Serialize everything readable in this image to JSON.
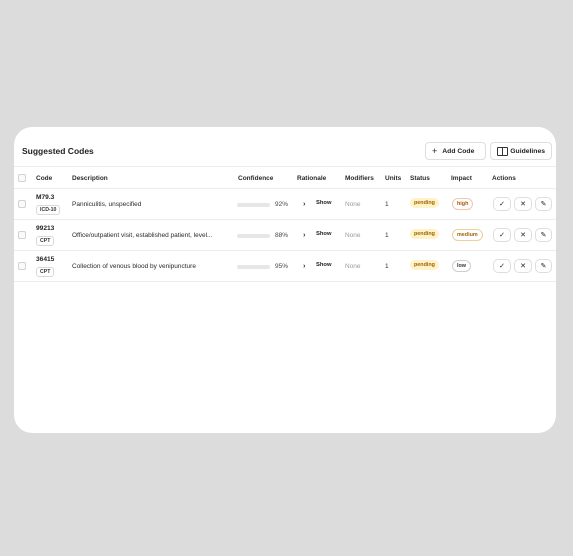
{
  "panel": {
    "title": "Suggested Codes",
    "add_label": "Add Code",
    "guidelines_label": "Guidelines"
  },
  "columns": {
    "code": "Code",
    "description": "Description",
    "confidence": "Confidence",
    "rationale": "Rationale",
    "modifiers": "Modifiers",
    "units": "Units",
    "status": "Status",
    "impact": "Impact",
    "actions": "Actions"
  },
  "rows": [
    {
      "code": "M79.3",
      "code_type": "ICD-10",
      "description": "Panniculitis, unspecified",
      "confidence": 0.92,
      "confidence_label": "92%",
      "rationale_label": "Show",
      "modifiers": "None",
      "units": "1",
      "status": "pending",
      "impact": "high"
    },
    {
      "code": "99213",
      "code_type": "CPT",
      "description": "Office/outpatient visit, established patient, level...",
      "confidence": 0.88,
      "confidence_label": "88%",
      "rationale_label": "Show",
      "modifiers": "None",
      "units": "1",
      "status": "pending",
      "impact": "medium"
    },
    {
      "code": "36415",
      "code_type": "CPT",
      "description": "Collection of venous blood by venipuncture",
      "confidence": 0.95,
      "confidence_label": "95%",
      "rationale_label": "Show",
      "modifiers": "None",
      "units": "1",
      "status": "pending",
      "impact": "low"
    }
  ],
  "colors": {
    "confidence_bar": "#22c55e",
    "status_pending_bg": "#fef3c7",
    "status_pending_text": "#a16207"
  },
  "icons": {
    "add": "plus-icon",
    "guidelines": "book-icon",
    "rationale": "chevron-right-icon",
    "accept": "check-icon",
    "reject": "close-icon",
    "edit": "edit-icon"
  }
}
